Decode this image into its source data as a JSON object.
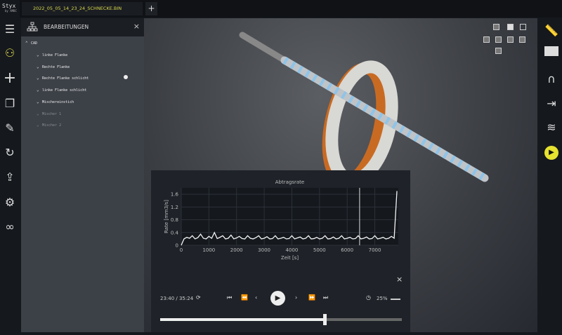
{
  "app": {
    "logo": "Styx",
    "logo_sub": "by AMBC"
  },
  "tabs": [
    {
      "label": "2022_05_05_14_23_24_SCHNECKE.BIN"
    }
  ],
  "add_tab": "+",
  "panel": {
    "title": "BEARBEITUNGEN",
    "close": "×",
    "root": "CAD",
    "items": [
      {
        "label": "linke Flanke",
        "dim": false
      },
      {
        "label": "Rechte Flanke",
        "dim": false
      },
      {
        "label": "Rechte Flanke schlicht",
        "dim": false,
        "active": true
      },
      {
        "label": "linke Flanke schlicht",
        "dim": false
      },
      {
        "label": "Mischereinstich",
        "dim": false
      },
      {
        "label": "Mischer 1",
        "dim": true
      },
      {
        "label": "Mischer 2",
        "dim": true
      }
    ]
  },
  "chart_data": {
    "type": "line",
    "title": "Abtragsrate",
    "xlabel": "Zeit [s]",
    "ylabel": "Rate [mm3/s]",
    "xlim": [
      0,
      7850
    ],
    "ylim": [
      0,
      1.8
    ],
    "xticks": [
      0,
      1000,
      2000,
      3000,
      4000,
      5000,
      6000,
      7000
    ],
    "yticks": [
      0,
      0.4,
      0.8,
      1.2,
      1.6
    ],
    "cursor_x": 6450,
    "series": [
      {
        "name": "Abtragsrate",
        "x_step": 100,
        "values": [
          0,
          0.2,
          0.25,
          0.22,
          0.3,
          0.2,
          0.24,
          0.35,
          0.22,
          0.2,
          0.28,
          0.22,
          0.4,
          0.21,
          0.25,
          0.3,
          0.2,
          0.22,
          0.32,
          0.2,
          0.23,
          0.28,
          0.21,
          0.2,
          0.3,
          0.22,
          0.2,
          0.24,
          0.3,
          0.2,
          0.22,
          0.27,
          0.2,
          0.21,
          0.3,
          0.2,
          0.22,
          0.25,
          0.2,
          0.21,
          0.3,
          0.2,
          0.23,
          0.26,
          0.2,
          0.22,
          0.3,
          0.2,
          0.21,
          0.25,
          0.2,
          0.22,
          0.3,
          0.2,
          0.21,
          0.26,
          0.2,
          0.22,
          0.3,
          0.2,
          0.22,
          0.25,
          0.2,
          0.21,
          0.3,
          0.2,
          0.22,
          0.26,
          0.2,
          0.21,
          0.3,
          0.2,
          0.22,
          0.25,
          0.2,
          0.22,
          0.28,
          0.22,
          1.7
        ]
      }
    ]
  },
  "player": {
    "time": "23:40 / 35:24",
    "speed": "25%",
    "progress": 0.68,
    "close": "×"
  }
}
